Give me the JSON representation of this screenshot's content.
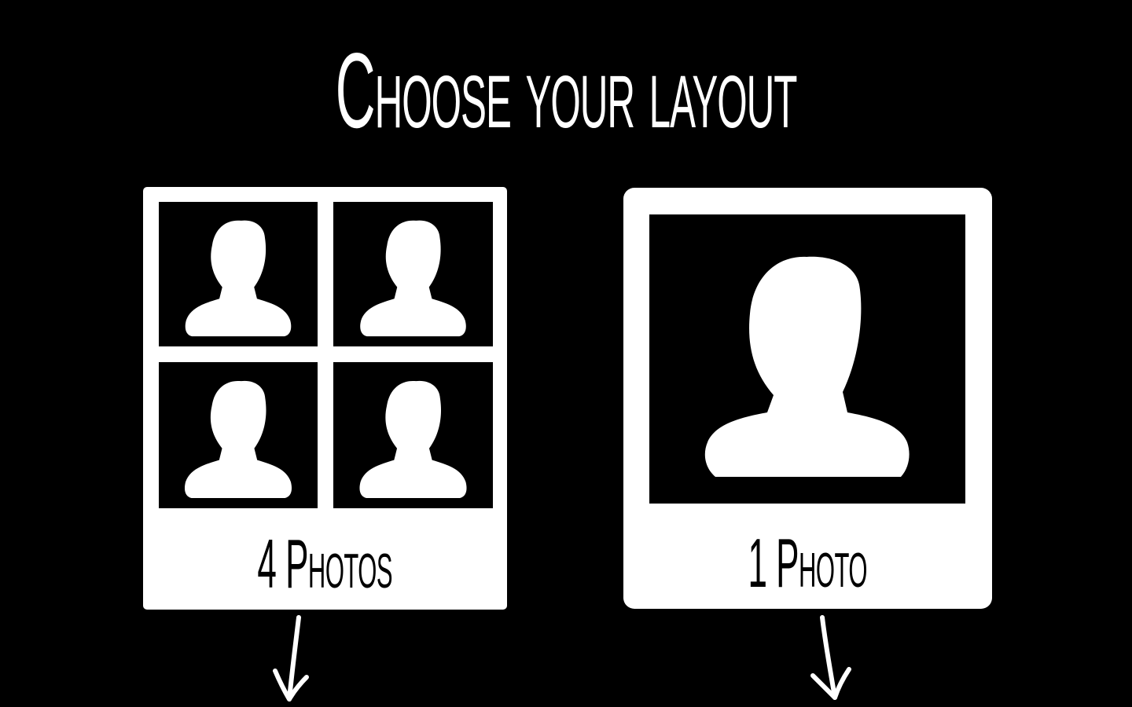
{
  "page": {
    "title": "Choose your layout",
    "background_color": "#000000",
    "foreground_color": "#ffffff"
  },
  "layouts": [
    {
      "label": "4 Photos",
      "photo_count": 4,
      "icon": "person-silhouette-icon",
      "indicator": "arrow-down-icon"
    },
    {
      "label": "1 Photo",
      "photo_count": 1,
      "icon": "person-silhouette-icon",
      "indicator": "arrow-down-icon"
    }
  ]
}
